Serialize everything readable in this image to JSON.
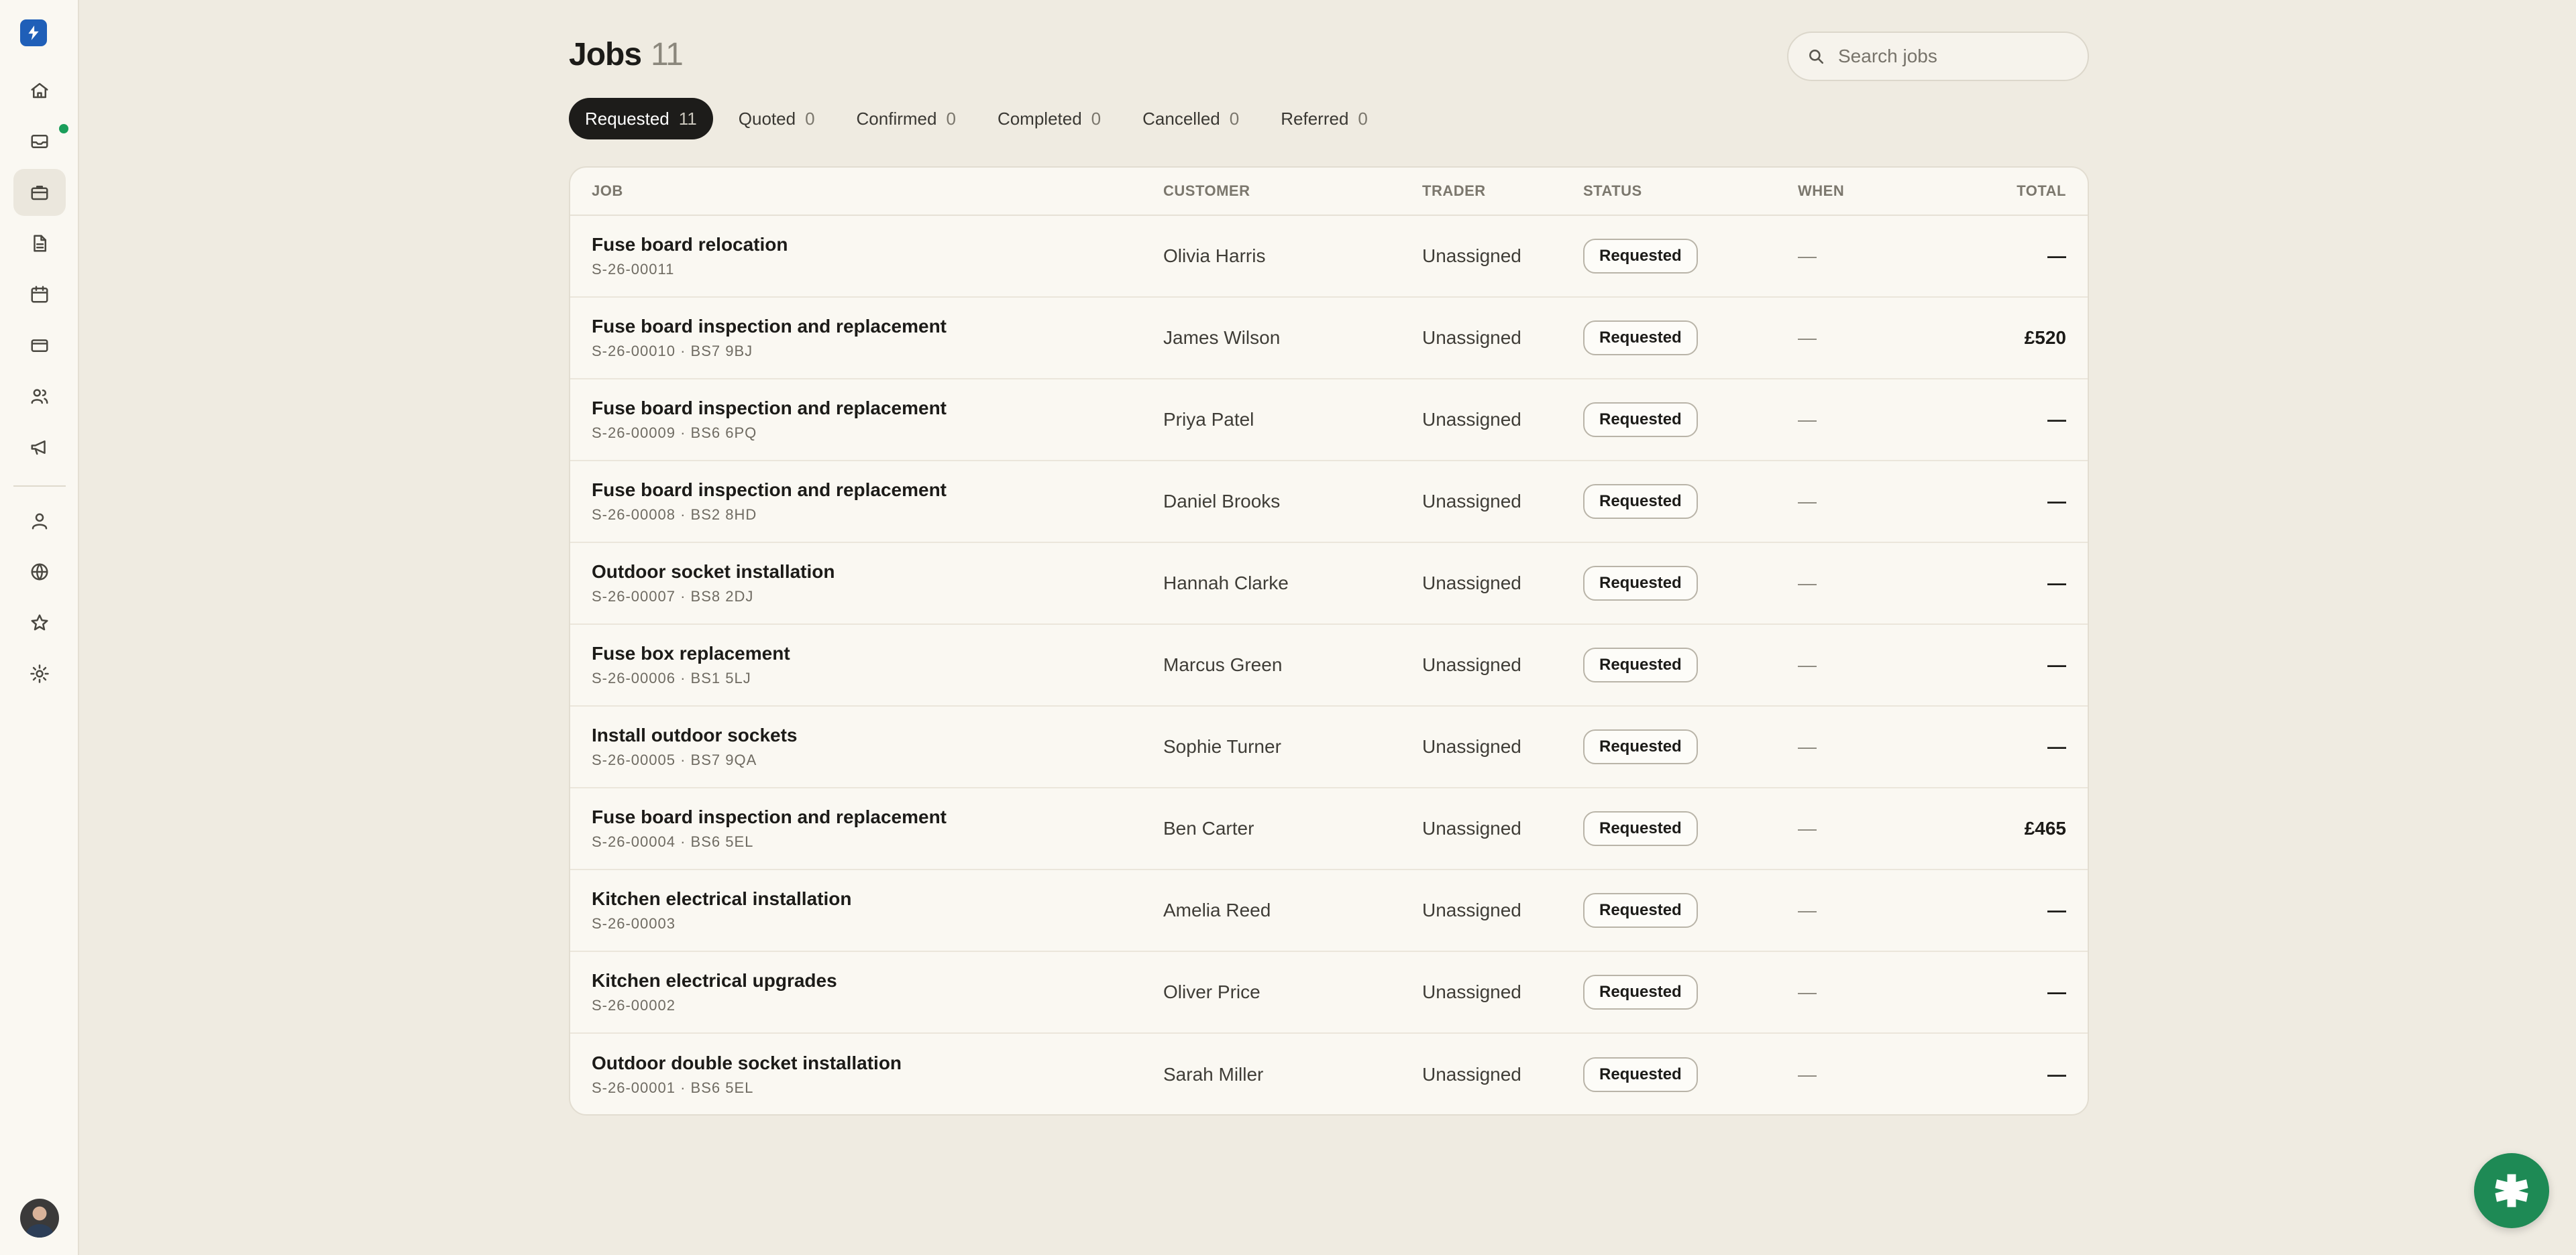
{
  "header": {
    "title": "Jobs",
    "count": "11",
    "search_placeholder": "Search jobs"
  },
  "sidebar": {
    "items": [
      {
        "name": "home-icon",
        "active": false
      },
      {
        "name": "inbox-icon",
        "active": false,
        "badge": true
      },
      {
        "name": "briefcase-icon",
        "active": true
      },
      {
        "name": "document-icon",
        "active": false
      },
      {
        "name": "calendar-icon",
        "active": false
      },
      {
        "name": "credit-card-icon",
        "active": false
      },
      {
        "name": "users-icon",
        "active": false
      },
      {
        "name": "megaphone-icon",
        "active": false
      },
      {
        "name": "person-icon",
        "active": false
      },
      {
        "name": "globe-icon",
        "active": false
      },
      {
        "name": "star-icon",
        "active": false
      },
      {
        "name": "settings-icon",
        "active": false
      }
    ],
    "badge_color": "#1a9e5a"
  },
  "tabs": [
    {
      "label": "Requested",
      "count": "11",
      "active": true
    },
    {
      "label": "Quoted",
      "count": "0",
      "active": false
    },
    {
      "label": "Confirmed",
      "count": "0",
      "active": false
    },
    {
      "label": "Completed",
      "count": "0",
      "active": false
    },
    {
      "label": "Cancelled",
      "count": "0",
      "active": false
    },
    {
      "label": "Referred",
      "count": "0",
      "active": false
    }
  ],
  "table": {
    "columns": {
      "job": "JOB",
      "customer": "CUSTOMER",
      "trader": "TRADER",
      "status": "STATUS",
      "when": "WHEN",
      "total": "TOTAL"
    },
    "rows": [
      {
        "title": "Fuse board relocation",
        "ref": "S-26-00011",
        "customer": "Olivia Harris",
        "trader": "Unassigned",
        "status": "Requested",
        "when": "—",
        "total": "—"
      },
      {
        "title": "Fuse board inspection and replacement",
        "ref": "S-26-00010 · BS7 9BJ",
        "customer": "James Wilson",
        "trader": "Unassigned",
        "status": "Requested",
        "when": "—",
        "total": "£520"
      },
      {
        "title": "Fuse board inspection and replacement",
        "ref": "S-26-00009 · BS6 6PQ",
        "customer": "Priya Patel",
        "trader": "Unassigned",
        "status": "Requested",
        "when": "—",
        "total": "—"
      },
      {
        "title": "Fuse board inspection and replacement",
        "ref": "S-26-00008 · BS2 8HD",
        "customer": "Daniel Brooks",
        "trader": "Unassigned",
        "status": "Requested",
        "when": "—",
        "total": "—"
      },
      {
        "title": "Outdoor socket installation",
        "ref": "S-26-00007 · BS8 2DJ",
        "customer": "Hannah Clarke",
        "trader": "Unassigned",
        "status": "Requested",
        "when": "—",
        "total": "—"
      },
      {
        "title": "Fuse box replacement",
        "ref": "S-26-00006 · BS1 5LJ",
        "customer": "Marcus Green",
        "trader": "Unassigned",
        "status": "Requested",
        "when": "—",
        "total": "—"
      },
      {
        "title": "Install outdoor sockets",
        "ref": "S-26-00005 · BS7 9QA",
        "customer": "Sophie Turner",
        "trader": "Unassigned",
        "status": "Requested",
        "when": "—",
        "total": "—"
      },
      {
        "title": "Fuse board inspection and replacement",
        "ref": "S-26-00004 · BS6 5EL",
        "customer": "Ben Carter",
        "trader": "Unassigned",
        "status": "Requested",
        "when": "—",
        "total": "£465"
      },
      {
        "title": "Kitchen electrical installation",
        "ref": "S-26-00003",
        "customer": "Amelia Reed",
        "trader": "Unassigned",
        "status": "Requested",
        "when": "—",
        "total": "—"
      },
      {
        "title": "Kitchen electrical upgrades",
        "ref": "S-26-00002",
        "customer": "Oliver Price",
        "trader": "Unassigned",
        "status": "Requested",
        "when": "—",
        "total": "—"
      },
      {
        "title": "Outdoor double socket installation",
        "ref": "S-26-00001 · BS6 5EL",
        "customer": "Sarah Miller",
        "trader": "Unassigned",
        "status": "Requested",
        "when": "—",
        "total": "—"
      }
    ]
  },
  "colors": {
    "brand": "#1f5fb8",
    "fab": "#1e8a55",
    "active_tab": "#1d1c1a"
  }
}
